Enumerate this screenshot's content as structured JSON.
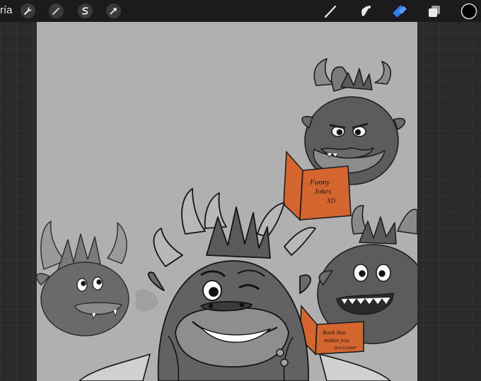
{
  "toolbar": {
    "gallery_label": "ría",
    "left_tools": [
      "wrench-icon",
      "magic-wand-icon",
      "selection-s-icon",
      "transform-arrow-icon"
    ],
    "right_tools": [
      "brush-icon",
      "smudge-icon",
      "eraser-icon",
      "layers-icon",
      "color-swatch"
    ],
    "active_tool": "eraser",
    "accent_color": "#2f7cf6",
    "current_color": "#000000"
  },
  "canvas": {
    "background_color": "#b0b0b0",
    "book_color": "#d5652e",
    "book1": {
      "lines": [
        "Funny",
        "Jokes",
        "XD"
      ]
    },
    "book2": {
      "lines": [
        "Book that",
        "makes you",
        "BOOGHMP"
      ]
    }
  }
}
